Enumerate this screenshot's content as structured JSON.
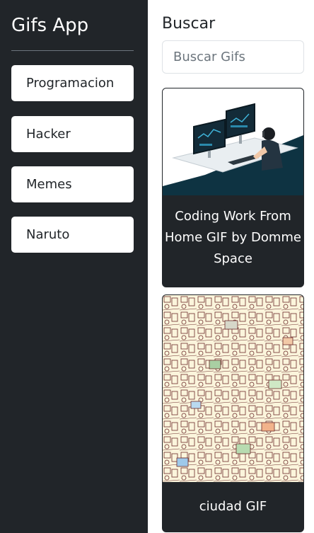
{
  "sidebar": {
    "brand": "Gifs App",
    "items": [
      {
        "label": "Programacion"
      },
      {
        "label": "Hacker"
      },
      {
        "label": "Memes"
      },
      {
        "label": "Naruto"
      }
    ]
  },
  "main": {
    "search_title": "Buscar",
    "search_placeholder": "Buscar Gifs",
    "search_value": "",
    "cards": [
      {
        "title": "Coding Work From Home GIF by Domme Space",
        "image": "gif-coding-work-from-home"
      },
      {
        "title": "ciudad GIF",
        "image": "gif-ciudad"
      }
    ]
  },
  "colors": {
    "sidebar_bg": "#212529",
    "card_bg": "#212529",
    "text_light": "#ffffff",
    "text_dark": "#212529"
  }
}
